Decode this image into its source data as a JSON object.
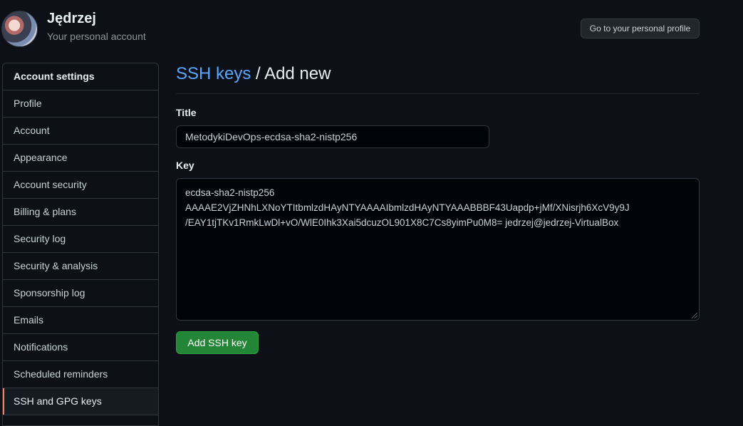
{
  "header": {
    "username": "Jędrzej",
    "subtitle": "Your personal account",
    "profile_button": "Go to your personal profile"
  },
  "sidebar": {
    "heading": "Account settings",
    "items": [
      {
        "label": "Profile"
      },
      {
        "label": "Account"
      },
      {
        "label": "Appearance"
      },
      {
        "label": "Account security"
      },
      {
        "label": "Billing & plans"
      },
      {
        "label": "Security log"
      },
      {
        "label": "Security & analysis"
      },
      {
        "label": "Sponsorship log"
      },
      {
        "label": "Emails"
      },
      {
        "label": "Notifications"
      },
      {
        "label": "Scheduled reminders"
      },
      {
        "label": "SSH and GPG keys",
        "active": true
      }
    ]
  },
  "main": {
    "breadcrumb_link": "SSH keys",
    "breadcrumb_sep": " / ",
    "breadcrumb_current": "Add new",
    "title_label": "Title",
    "title_value": "MetodykiDevOps-ecdsa-sha2-nistp256",
    "key_label": "Key",
    "key_lines": [
      "ecdsa-sha2-nistp256",
      "AAAAE2VjZHNhLXNoYTItbmlzdHAyNTYAAAAIbmlzdHAyNTYAAABBBF43Uapdp+jMf/XNisrjh6XcV9y9J",
      "/EAY1tjTKv1RmkLwDl+vO/WlE0Ihk3Xai5dcuzOL901X8C7Cs8yimPu0M8= jedrzej@jedrzej-VirtualBox"
    ],
    "submit_button": "Add SSH key"
  },
  "colors": {
    "background": "#0d1117",
    "link": "#58a6ff",
    "primary_button": "#238636",
    "active_marker": "#f78166"
  }
}
